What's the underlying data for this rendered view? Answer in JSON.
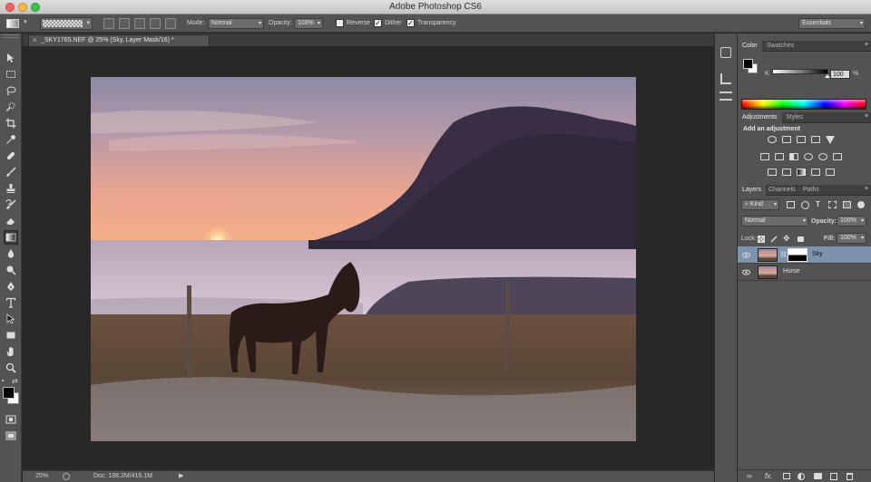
{
  "window": {
    "title": "Adobe Photoshop CS6"
  },
  "options": {
    "mode_label": "Mode:",
    "mode_value": "Normal",
    "opacity_label": "Opacity:",
    "opacity_value": "100%",
    "reverse_label": "Reverse",
    "dither_label": "Dither",
    "transparency_label": "Transparency",
    "workspace": "Essentials"
  },
  "document": {
    "tab_title": "_SKY1765.NEF @ 25% (Sky, Layer Mask/16) *",
    "close_glyph": "×"
  },
  "status": {
    "zoom": "25%",
    "doc_info": "Doc: 198.2M/416.1M"
  },
  "color_panel": {
    "tabs": [
      "Color",
      "Swatches"
    ],
    "channel_label": "K",
    "value": "100",
    "unit": "%",
    "k_level_percent": 100
  },
  "adjustments_panel": {
    "tabs": [
      "Adjustments",
      "Styles"
    ],
    "heading": "Add an adjustment"
  },
  "layers_panel": {
    "tabs": [
      "Layers",
      "Channels",
      "Paths"
    ],
    "filter_kind": "Kind",
    "blend_mode": "Normal",
    "opacity_label": "Opacity:",
    "opacity_value": "100%",
    "lock_label": "Lock:",
    "fill_label": "Fill:",
    "fill_value": "100%",
    "layers": [
      {
        "name": "Sky",
        "selected": true,
        "has_mask": true
      },
      {
        "name": "Horse",
        "selected": false,
        "has_mask": false
      }
    ],
    "footer_fx": "fx."
  },
  "colors": {
    "selected_layer": "#7d92ad",
    "panel_bg": "#535353",
    "canvas_bg": "#282828"
  }
}
